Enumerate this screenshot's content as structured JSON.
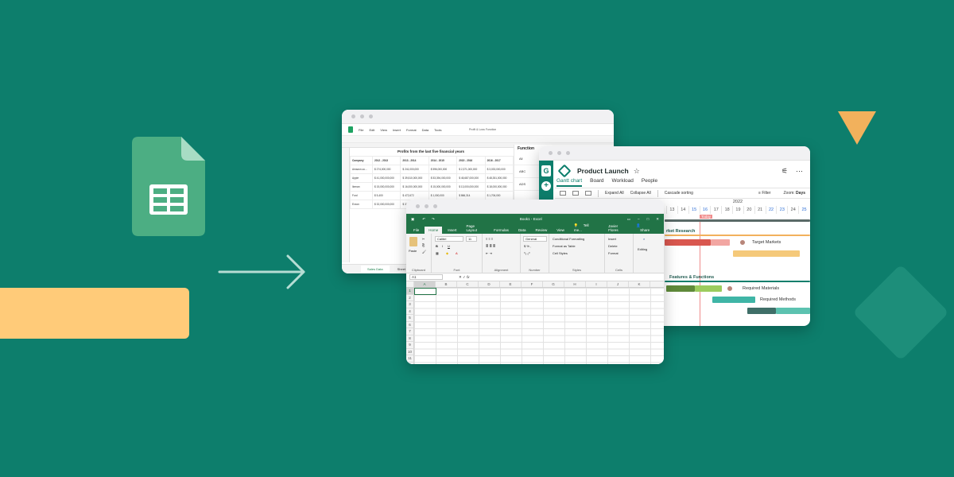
{
  "colors": {
    "background": "#0d7e6c",
    "accent_yellow": "#ffcb79",
    "triangle": "#f2b15c",
    "excel_green": "#217346",
    "sheets_green": "#4cae83"
  },
  "icons": [
    "google-sheets-icon",
    "arrow-right-icon"
  ],
  "google_sheets": {
    "title": "Profit & Loss Function",
    "menu": [
      "File",
      "Edit",
      "View",
      "Insert",
      "Format",
      "Data",
      "Tools"
    ],
    "sheet_title": "Profits from the last five financial years",
    "headers": [
      "Company",
      "2012 - 2013",
      "2013 - 2014",
      "2014 - 2015",
      "2015 - 2016",
      "2016 - 2017"
    ],
    "rows": [
      [
        "Amazon.co...",
        "$ 274,000,000",
        "$ 241,000,000",
        "$ 596,000,000",
        "$ 2,371,000,000",
        "$ 3,033,000,000"
      ],
      [
        "Apple",
        "$ 41,000,000,000",
        "$ 39,510,000,000",
        "$ 53,394,000,000",
        "$ 45,687,000,000",
        "$ 48,351,000,000"
      ],
      [
        "Ikenan",
        "$ 15,000,000,000",
        "$ 16,000,000,000",
        "$ 15,000,000,000",
        "$ 13,000,000,000",
        "$ 18,000,000,000"
      ],
      [
        "Ford",
        "$ 5,400",
        "$ 472,672",
        "$ 1,000,000",
        "$ 866,314",
        "$ 1,706,000"
      ],
      [
        "Exxon",
        "$ 32,000,000,000",
        "$ 32,000,000,000",
        "$ 32,000,000,000",
        "$ 32,000,000,000",
        "$ 32,000,000,000"
      ]
    ],
    "side_title": "Function",
    "side_items": [
      "All",
      "ABC",
      "ADS"
    ],
    "tabs": [
      "Sales Data",
      "Sheet 2"
    ]
  },
  "gantt": {
    "title": "Product Launch",
    "tabs": [
      "Gantt chart",
      "Board",
      "Workload",
      "People"
    ],
    "tools": [
      "Expand All",
      "Collapse All",
      "Cascade sorting"
    ],
    "filter": "Filter",
    "zoom_label": "Zoom:",
    "zoom_value": "Days",
    "year": "2022",
    "days": [
      "13",
      "14",
      "15",
      "16",
      "17",
      "18",
      "19",
      "20",
      "21",
      "22",
      "23",
      "24",
      "25"
    ],
    "today": "Today",
    "sections": [
      "rket Research",
      "Features & Functions"
    ],
    "tasks": [
      "Target Markets",
      "Required Materials",
      "Required Methods"
    ]
  },
  "excel": {
    "title": "Book1 - Excel",
    "tabs": [
      "File",
      "Home",
      "Insert",
      "Page Layout",
      "Formulas",
      "Data",
      "Review",
      "View"
    ],
    "tell_me": "Tell me...",
    "user": "Javier Flores",
    "share": "Share",
    "paste": "Paste",
    "font_name": "Calibri",
    "font_size": "11",
    "number_format": "General",
    "styles": [
      "Conditional Formatting",
      "Format as Table",
      "Cell Styles"
    ],
    "cells": [
      "Insert",
      "Delete",
      "Format"
    ],
    "editing": "Editing",
    "groups": [
      "Clipboard",
      "Font",
      "Alignment",
      "Number",
      "Styles",
      "Cells"
    ],
    "name_box": "A1",
    "fx": "fx",
    "columns": [
      "A",
      "B",
      "C",
      "D",
      "E",
      "F",
      "G",
      "H",
      "I",
      "J",
      "K"
    ],
    "rows": [
      "1",
      "2",
      "3",
      "4",
      "5",
      "6",
      "7",
      "8",
      "9",
      "10",
      "11",
      "12"
    ]
  }
}
